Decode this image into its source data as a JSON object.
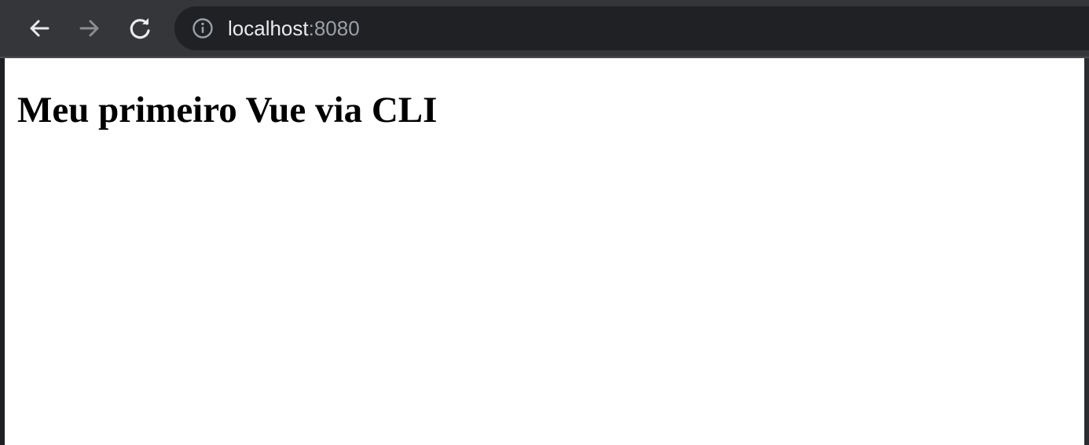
{
  "browser": {
    "address_bar": {
      "host": "localhost",
      "port": ":8080"
    },
    "icons": {
      "back": "back-arrow-icon",
      "forward": "forward-arrow-icon",
      "reload": "reload-icon",
      "site_info": "info-icon"
    },
    "colors": {
      "toolbar": "#35363a",
      "omnibox": "#202124",
      "url_primary": "#e8eaed",
      "url_secondary": "#9aa0a6"
    }
  },
  "page": {
    "heading": "Meu primeiro Vue via CLI"
  }
}
